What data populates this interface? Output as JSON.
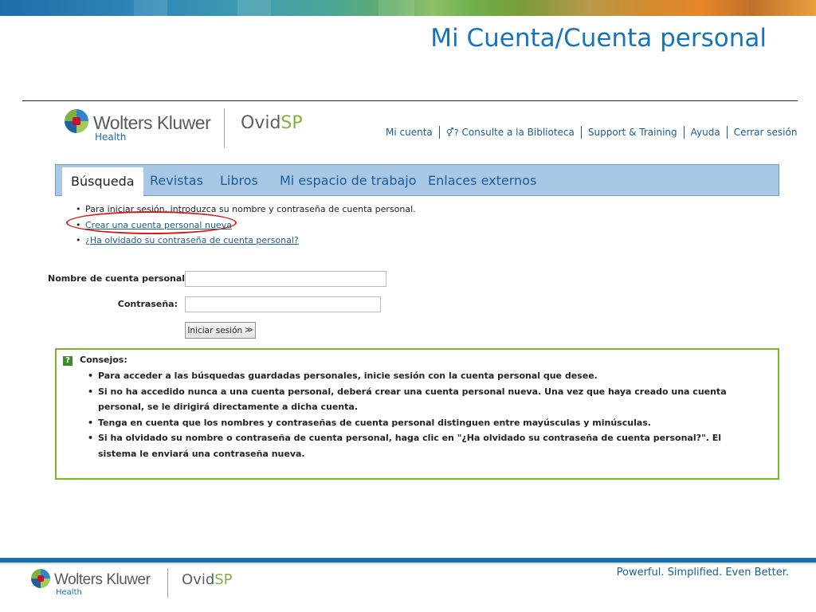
{
  "slide": {
    "title": "Mi Cuenta/Cuenta personal",
    "tagline": "Powerful. Simplified. Even Better."
  },
  "brand": {
    "name": "Wolters Kluwer",
    "division": "Health",
    "product_main": "Ovid",
    "product_accent": "SP",
    "colors": {
      "blue": "#1873b8",
      "green": "#76b82a",
      "red": "#c8102e"
    }
  },
  "top_nav": {
    "items": [
      {
        "label": "Mi cuenta",
        "icon": ""
      },
      {
        "label": "Consulte a la Biblioteca",
        "icon": "librarian-icon"
      },
      {
        "label": "Support & Training",
        "icon": ""
      },
      {
        "label": "Ayuda",
        "icon": ""
      },
      {
        "label": "Cerrar sesión",
        "icon": ""
      }
    ]
  },
  "tabs": {
    "active": "Búsqueda",
    "items": [
      "Búsqueda",
      "Revistas",
      "Libros",
      "Mi espacio de trabajo",
      "Enlaces externos"
    ]
  },
  "info": {
    "instruction": "Para iniciar sesión, introduzca su nombre y contraseña de cuenta personal.",
    "create_link": "Crear una cuenta personal nueva",
    "forgot_link": "¿Ha olvidado su contraseña de cuenta personal?"
  },
  "form": {
    "username_label": "Nombre de cuenta personal:",
    "username_value": "",
    "password_label": "Contraseña:",
    "password_value": "",
    "submit_label": "Iniciar sesión",
    "submit_icon": "double-chevron-right-icon"
  },
  "tips": {
    "icon": "help-question-icon",
    "title": "Consejos:",
    "items": [
      "Para acceder a las búsquedas guardadas personales, inicie sesión con la cuenta personal que desee.",
      "Si no ha accedido nunca a una cuenta personal, deberá crear una cuenta personal nueva. Una vez que haya creado una cuenta personal, se le dirigirá directamente a dicha cuenta.",
      "Tenga en cuenta que los nombres y contraseñas de cuenta personal distinguen entre mayúsculas y minúsculas.",
      "Si ha olvidado su nombre o contraseña de cuenta personal, haga clic en \"¿Ha olvidado su contraseña de cuenta personal?\". El sistema le enviará una contraseña nueva."
    ]
  }
}
